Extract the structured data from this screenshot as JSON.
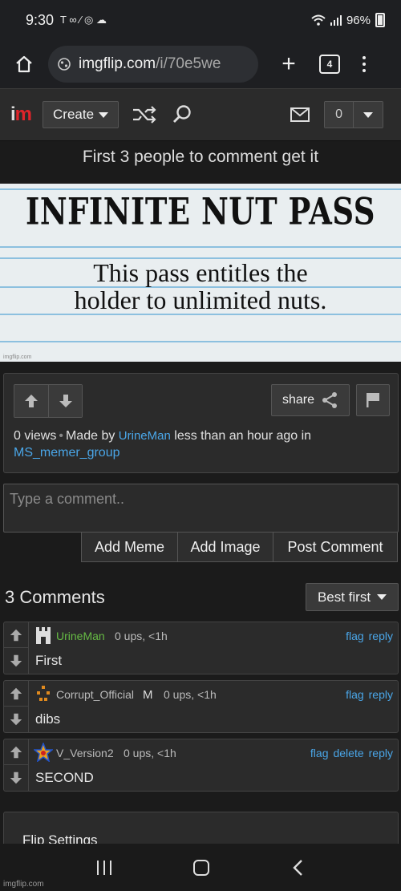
{
  "status_bar": {
    "time": "9:30",
    "left_icons": "T ∞ ⁄ ◎ ☁",
    "battery": "96%"
  },
  "browser": {
    "url_host": "imgflip.com",
    "url_path": "/i/70e5we",
    "tab_count": "4"
  },
  "site_header": {
    "logo_i": "i",
    "logo_m": "m",
    "create_label": "Create",
    "notification_count": "0"
  },
  "page": {
    "title": "First 3 people to comment get it"
  },
  "meme": {
    "heading": "INFINITE NUT PASS",
    "line1": "This pass entitles the",
    "line2": "holder to unlimited nuts.",
    "watermark": "imgflip.com"
  },
  "meta": {
    "views": "0 views",
    "made_by": "Made by",
    "author": "UrineMan",
    "time_text": "less than an hour ago in",
    "group": "MS_memer_group",
    "share_label": "share"
  },
  "comment_box": {
    "placeholder": "Type a comment..",
    "add_meme": "Add Meme",
    "add_image": "Add Image",
    "post_comment": "Post Comment"
  },
  "comments_section": {
    "count_label": "3 Comments",
    "sort_label": "Best first",
    "items": [
      {
        "user": "UrineMan",
        "user_color": "#66bb44",
        "badge": "",
        "meta": "0 ups, <1h",
        "links": [
          "flag",
          "reply"
        ],
        "text": "First"
      },
      {
        "user": "Corrupt_Official",
        "user_color": "#bbbbbb",
        "badge": "M",
        "meta": "0 ups, <1h",
        "links": [
          "flag",
          "reply"
        ],
        "text": "dibs"
      },
      {
        "user": "V_Version2",
        "user_color": "#bbbbbb",
        "badge": "",
        "meta": "0 ups, <1h",
        "links": [
          "flag",
          "delete",
          "reply"
        ],
        "text": "SECOND"
      }
    ]
  },
  "flip_settings": {
    "label": "Flip Settings"
  },
  "footer": {
    "watermark": "imgflip.com"
  },
  "colors": {
    "link": "#4aa6e8",
    "logo_red": "#e0242a",
    "background": "#1b1b1b",
    "panel": "#2b2b2b"
  }
}
